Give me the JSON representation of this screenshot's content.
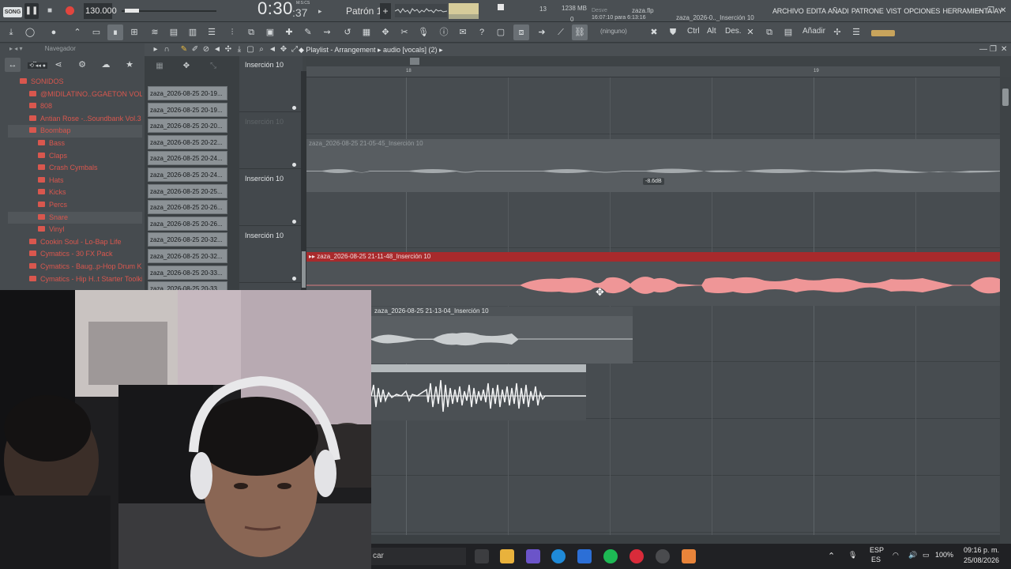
{
  "transport": {
    "song_mode": "SONG",
    "play_icon": "pause-icon",
    "stop_icon": "stop-icon",
    "record_icon": "record-icon",
    "tempo": "130.000",
    "time_main": "0:30",
    "time_sub": ":37",
    "time_unit": "M:S:CS",
    "pattern": "Patrón 1",
    "pattern_add": "+",
    "polyphony": "13",
    "polyphony_zero": "0",
    "memory": "1238 MB",
    "hint_label": "Desve",
    "hint_time": "16:07:10 para 6:13:16",
    "file_name": "zaza.flp",
    "hint_track": "zaza_2026-0.._Inserción 10"
  },
  "menu": {
    "items": "ARCHIVO EDITA AÑADI PATRONE VIST OPCIONES HERRAMIENTA AY",
    "minimize": "—",
    "restore": "❐",
    "close": "✕"
  },
  "toolbar": {
    "ninguno": "(ninguno)",
    "ctrl": "Ctrl",
    "alt": "Alt",
    "des": "Des.",
    "add": "Añadir"
  },
  "browser": {
    "title": "Navegador",
    "items": [
      {
        "label": "SONIDOS",
        "level": 0
      },
      {
        "label": "@MIDILATINO..GGAETON VOL. 1",
        "level": 1
      },
      {
        "label": "808",
        "level": 1
      },
      {
        "label": "Antian Rose -..Soundbank Vol.3",
        "level": 1
      },
      {
        "label": "Boombap",
        "level": 1
      },
      {
        "label": "Bass",
        "level": 2
      },
      {
        "label": "Claps",
        "level": 2
      },
      {
        "label": "Crash Cymbals",
        "level": 2
      },
      {
        "label": "Hats",
        "level": 2
      },
      {
        "label": "Kicks",
        "level": 2
      },
      {
        "label": "Percs",
        "level": 2
      },
      {
        "label": "Snare",
        "level": 2
      },
      {
        "label": "Vinyl",
        "level": 2
      },
      {
        "label": "Cookin Soul - Lo-Bap Life",
        "level": 1
      },
      {
        "label": "Cymatics - 30 FX Pack",
        "level": 1
      },
      {
        "label": "Cymatics - Baug..p-Hop Drum Kit",
        "level": 1
      },
      {
        "label": "Cymatics - Hip H..t Starter Toolkit",
        "level": 1
      }
    ]
  },
  "clips": [
    "zaza_2026-08-25 20-19...",
    "zaza_2026-08-25 20-19...",
    "zaza_2026-08-25 20-20...",
    "zaza_2026-08-25 20-22...",
    "zaza_2026-08-25 20-24...",
    "zaza_2026-08-25 20-24...",
    "zaza_2026-08-25 20-25...",
    "zaza_2026-08-25 20-26...",
    "zaza_2026-08-25 20-26...",
    "zaza_2026-08-25 20-32...",
    "zaza_2026-08-25 20-32...",
    "zaza_2026-08-25 20-33...",
    "zaza_2026-08-25 20-33..."
  ],
  "playlist": {
    "title": "Playlist - Arrangement",
    "breadcrumb": "audio [vocals] (2)",
    "ruler_marks": [
      "18",
      "19"
    ],
    "tracks": [
      {
        "name": "Inserción 10",
        "dim": false
      },
      {
        "name": "Inserción 10",
        "dim": true
      },
      {
        "name": "Inserción 10",
        "dim": false
      },
      {
        "name": "Inserción 10",
        "dim": false
      }
    ],
    "clip_names": [
      "zaza_2026-08-25 21-05-45_Inserción 10",
      "zaza_2026-08-25 21-11-48_Inserción 10",
      "zaza_2026-08-25 21-13-04_Inserción 10",
      ""
    ],
    "volume_label": "-8.6dB"
  },
  "taskbar": {
    "search": "car",
    "lang": "ESP",
    "lang_sub": "ES",
    "battery": "100%",
    "time": "09:16 p. m.",
    "date": "25/08/2026"
  },
  "colors": {
    "accent_red": "#a82a2c",
    "waveform_pink": "#ef9697",
    "browser_red": "#d9574e"
  }
}
